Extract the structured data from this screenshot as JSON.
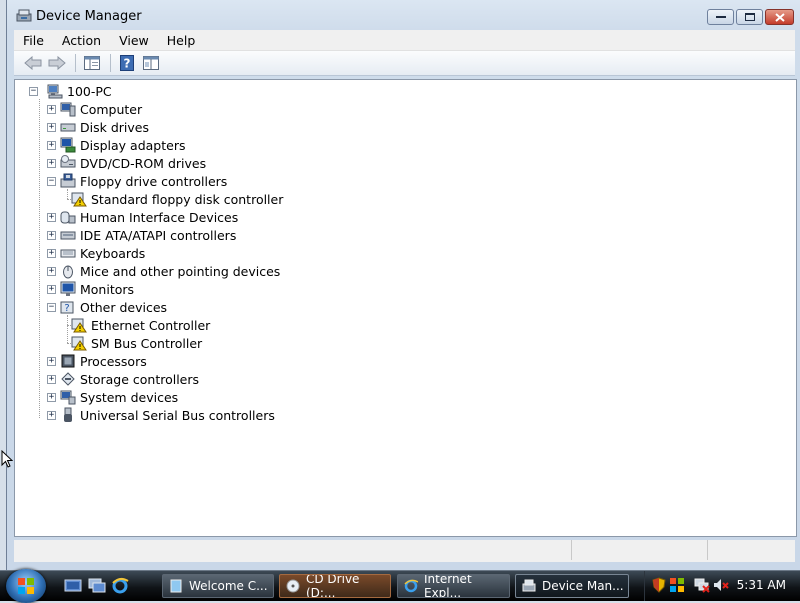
{
  "window": {
    "title": "Device Manager",
    "icon": "device-manager-icon",
    "controls": [
      "minimize",
      "maximize",
      "close"
    ]
  },
  "menu": [
    "File",
    "Action",
    "View",
    "Help"
  ],
  "toolbar": [
    "back-arrow-icon",
    "forward-arrow-icon",
    "properties-pane-icon",
    "help-icon",
    "properties-icon"
  ],
  "tree": {
    "root": "100-PC",
    "categories": [
      {
        "label": "Computer",
        "expanded": false,
        "icon": "computer-icon"
      },
      {
        "label": "Disk drives",
        "expanded": false,
        "icon": "disk-drive-icon"
      },
      {
        "label": "Display adapters",
        "expanded": false,
        "icon": "display-adapter-icon"
      },
      {
        "label": "DVD/CD-ROM drives",
        "expanded": false,
        "icon": "dvd-drive-icon"
      },
      {
        "label": "Floppy drive controllers",
        "expanded": true,
        "icon": "floppy-controller-icon",
        "children": [
          {
            "label": "Standard floppy disk controller",
            "warning": true
          }
        ]
      },
      {
        "label": "Human Interface Devices",
        "expanded": false,
        "icon": "hid-icon"
      },
      {
        "label": "IDE ATA/ATAPI controllers",
        "expanded": false,
        "icon": "ide-controller-icon"
      },
      {
        "label": "Keyboards",
        "expanded": false,
        "icon": "keyboard-icon"
      },
      {
        "label": "Mice and other pointing devices",
        "expanded": false,
        "icon": "mouse-icon"
      },
      {
        "label": "Monitors",
        "expanded": false,
        "icon": "monitor-icon"
      },
      {
        "label": "Other devices",
        "expanded": true,
        "icon": "other-devices-icon",
        "children": [
          {
            "label": "Ethernet Controller",
            "warning": true
          },
          {
            "label": "SM Bus Controller",
            "warning": true
          }
        ]
      },
      {
        "label": "Processors",
        "expanded": false,
        "icon": "processor-icon"
      },
      {
        "label": "Storage controllers",
        "expanded": false,
        "icon": "storage-controller-icon"
      },
      {
        "label": "System devices",
        "expanded": false,
        "icon": "system-devices-icon"
      },
      {
        "label": "Universal Serial Bus controllers",
        "expanded": false,
        "icon": "usb-icon"
      }
    ]
  },
  "taskbar": {
    "tasks": [
      {
        "label": "Welcome C...",
        "icon": "welcome-center-icon",
        "state": "normal"
      },
      {
        "label": "CD Drive (D:...",
        "icon": "cd-drive-icon",
        "state": "flashing"
      },
      {
        "label": "Internet Expl...",
        "icon": "internet-explorer-icon",
        "state": "normal"
      },
      {
        "label": "Device Man...",
        "icon": "device-manager-icon",
        "state": "active"
      }
    ],
    "clock": "5:31 AM"
  },
  "colors": {
    "window_frame": "#c9d7e8",
    "taskbar": "#101418",
    "warning_yellow": "#f4d000"
  }
}
